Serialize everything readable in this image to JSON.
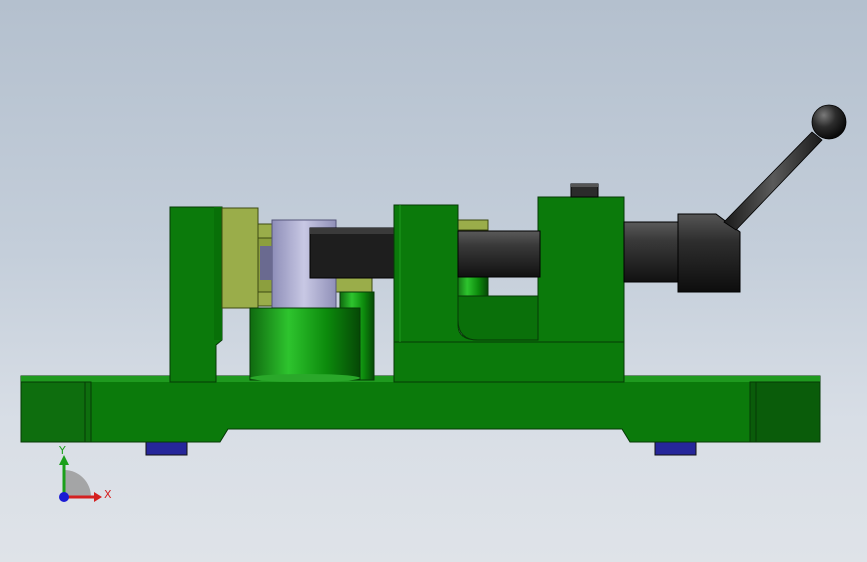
{
  "viewport": {
    "background_top": "#b4c0ce",
    "background_bottom": "#dfe3e8"
  },
  "model": {
    "part_colors": {
      "body_green": "#0b7a0b",
      "body_green_dark": "#055a05",
      "body_green_light": "#2aa82a",
      "fixture_olive": "#9aad4a",
      "cylinder_lavender": "#b6b6d8",
      "steel_dark": "#2a2a2a",
      "handle_black": "#1c1c1c",
      "foot_blue": "#2a2aa0"
    }
  },
  "triad": {
    "x_label": "X",
    "y_label": "Y",
    "x_color": "#d42020",
    "y_color": "#1aa01a",
    "z_color": "#1a1ad4"
  }
}
